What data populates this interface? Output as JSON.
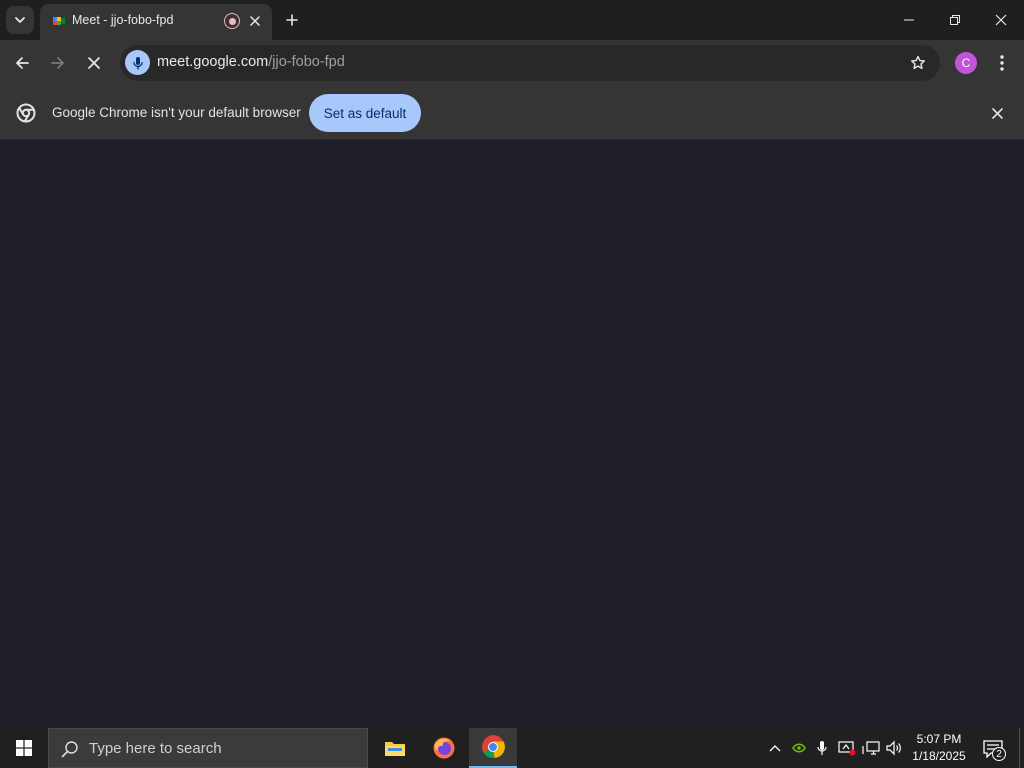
{
  "tab": {
    "title": "Meet - jjo-fobo-fpd",
    "favicon": "google-meet-icon",
    "recording_indicator": "record-icon"
  },
  "omnibox": {
    "url_host": "meet.google.com",
    "url_path": "/jjo-fobo-fpd"
  },
  "profile": {
    "initial": "C",
    "color": "#c255d6"
  },
  "infobar": {
    "message": "Google Chrome isn't your default browser",
    "button_label": "Set as default"
  },
  "taskbar": {
    "search_placeholder": "Type here to search",
    "pinned_apps": [
      "file-explorer-icon",
      "firefox-icon",
      "chrome-icon"
    ],
    "active_app": "chrome-icon",
    "time": "5:07 PM",
    "date": "1/18/2025",
    "notification_count": "2"
  },
  "colors": {
    "accent": "#a8c7fa",
    "page_background": "#1f1f2a",
    "toolbar": "#353535"
  }
}
